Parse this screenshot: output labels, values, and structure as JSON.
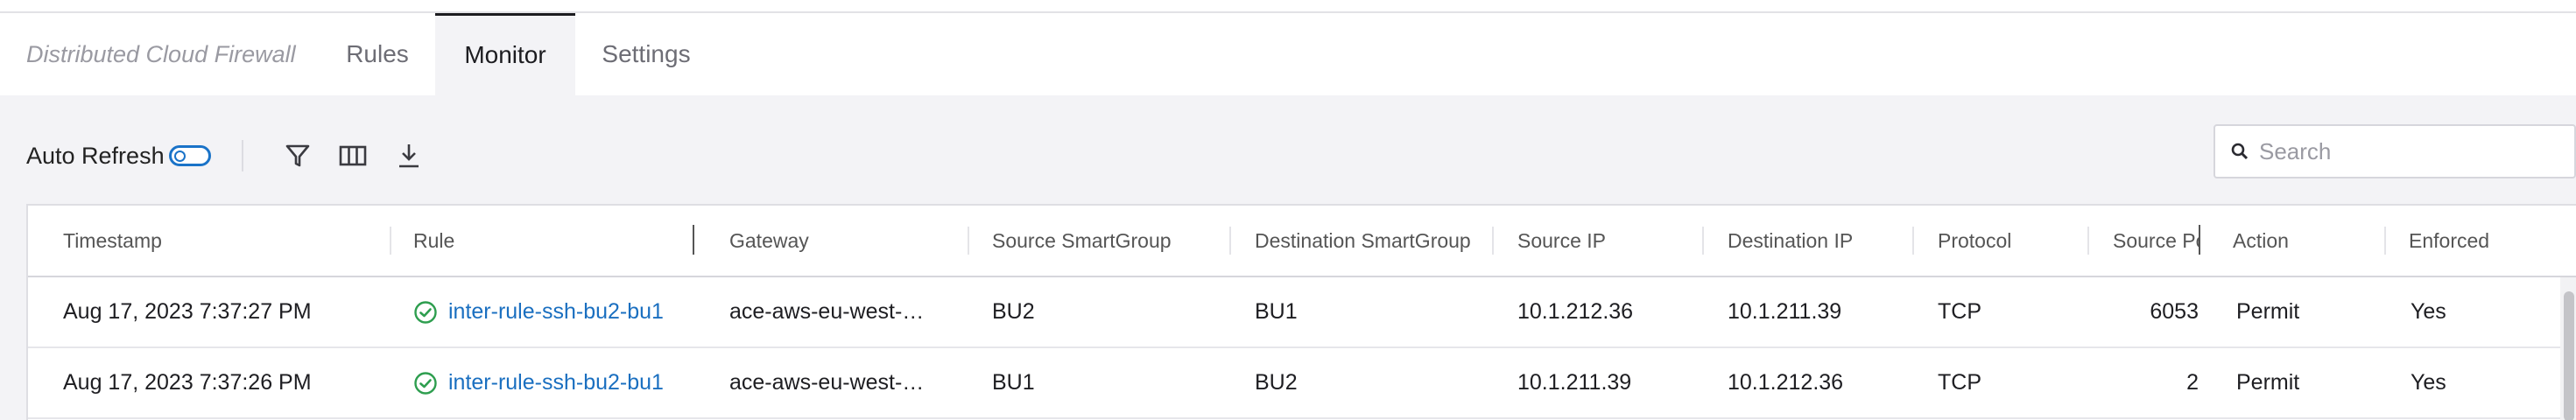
{
  "tabs": {
    "crumb": "Distributed Cloud Firewall",
    "items": [
      "Rules",
      "Monitor",
      "Settings"
    ],
    "active": "Monitor"
  },
  "toolbar": {
    "auto_refresh_label": "Auto Refresh",
    "auto_refresh_on": false,
    "icons": [
      "filter-icon",
      "columns-icon",
      "download-icon"
    ]
  },
  "search": {
    "placeholder": "Search"
  },
  "table": {
    "columns": [
      "Timestamp",
      "Rule",
      "Gateway",
      "Source SmartGroup",
      "Destination SmartGroup",
      "Source IP",
      "Destination IP",
      "Protocol",
      "Source Po",
      "Action",
      "Enforced"
    ],
    "rows": [
      {
        "timestamp": "Aug 17, 2023 7:37:27 PM",
        "rule": "inter-rule-ssh-bu2-bu1",
        "gateway": "ace-aws-eu-west-…",
        "src_group": "BU2",
        "dst_group": "BU1",
        "src_ip": "10.1.212.36",
        "dst_ip": "10.1.211.39",
        "protocol": "TCP",
        "src_port": "6053",
        "action": "Permit",
        "enforced": "Yes"
      },
      {
        "timestamp": "Aug 17, 2023 7:37:26 PM",
        "rule": "inter-rule-ssh-bu2-bu1",
        "gateway": "ace-aws-eu-west-…",
        "src_group": "BU1",
        "dst_group": "BU2",
        "src_ip": "10.1.211.39",
        "dst_ip": "10.1.212.36",
        "protocol": "TCP",
        "src_port": "2",
        "action": "Permit",
        "enforced": "Yes"
      }
    ]
  },
  "colors": {
    "accent": "#1a73c8",
    "link": "#1a6fc0",
    "success": "#2e9e4f"
  }
}
